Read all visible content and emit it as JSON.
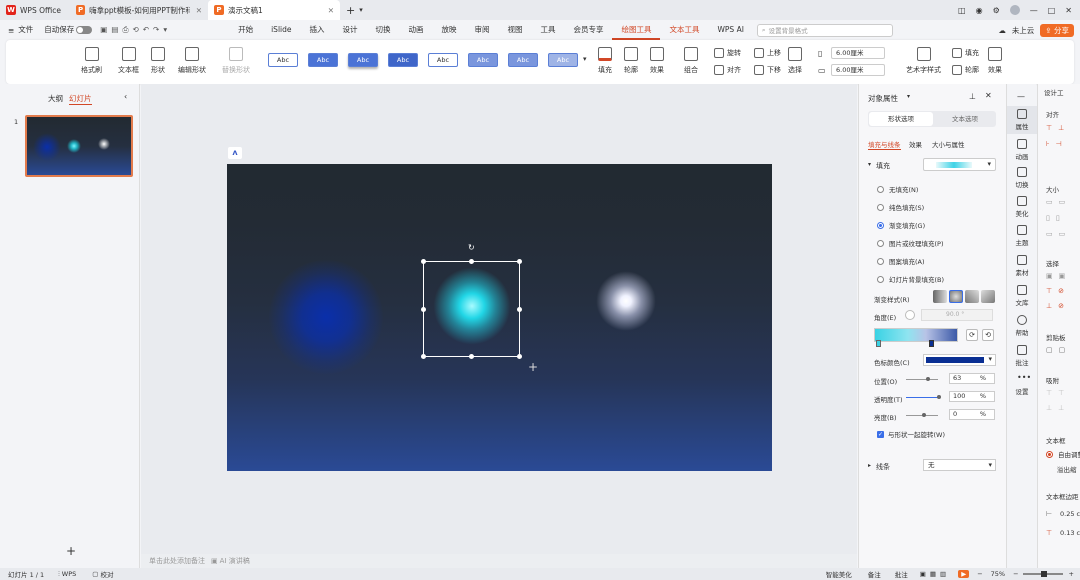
{
  "titlebar": {
    "tabs": [
      {
        "label": "WPS Office"
      },
      {
        "label": "嗨拿ppt模板-如何用PPT制作科技感..."
      },
      {
        "label": "演示文稿1"
      }
    ],
    "new_tab": "+"
  },
  "menubar": {
    "file": "文件",
    "autosave": "自动保存",
    "items": [
      "开始",
      "iSlide",
      "插入",
      "设计",
      "切换",
      "动画",
      "放映",
      "审阅",
      "视图",
      "工具",
      "会员专享",
      "绘图工具",
      "文本工具",
      "WPS AI"
    ],
    "search_placeholder": "设置背景格式",
    "cloud": "未上云",
    "share": "分享"
  },
  "ribbon": {
    "format_painter": "格式刷",
    "textbox": "文本框",
    "shape": "形状",
    "edit_shape": "编辑形状",
    "replace_shape": "替换形状",
    "style_label": "Abc",
    "fill": "填充",
    "outline": "轮廓",
    "effect": "效果",
    "group": "组合",
    "rotate": "旋转",
    "align": "对齐",
    "up": "上移",
    "down": "下移",
    "select": "选择",
    "height": "6.00厘米",
    "width": "6.00厘米",
    "art_text": "艺术字样式",
    "fill2": "填充",
    "outline2": "轮廓",
    "effect2": "效果"
  },
  "leftpanel": {
    "tab_outline": "大纲",
    "tab_slides": "幻灯片",
    "slide_number": "1",
    "add": "+"
  },
  "notes": {
    "placeholder": "单击此处添加备注",
    "ai": "AI 演讲稿"
  },
  "props": {
    "title": "对象属性",
    "tab_shape": "形状选项",
    "tab_text": "文本选项",
    "sub_fill": "填充与线条",
    "sub_effect": "效果",
    "sub_size": "大小与属性",
    "fill_section": "填充",
    "options": [
      "无填充(N)",
      "纯色填充(S)",
      "渐变填充(G)",
      "图片或纹理填充(P)",
      "图案填充(A)",
      "幻灯片背景填充(B)"
    ],
    "selected_option": 2,
    "gradient_style": "渐变样式(R)",
    "angle": "角度(E)",
    "angle_value": "90.0 °",
    "stop_color": "色标颜色(C)",
    "stop_color_value": "#0a2f93",
    "position": "位置(O)",
    "position_value": "63",
    "transparency": "透明度(T)",
    "transparency_value": "100",
    "brightness": "亮度(B)",
    "brightness_value": "0",
    "percent": "%",
    "rotate_with_shape": "与形状一起旋转(W)",
    "line_section": "线条",
    "line_value": "无"
  },
  "strip": [
    "属性",
    "动画",
    "切换",
    "美化",
    "主题",
    "素材",
    "文库",
    "帮助",
    "批注",
    "设置"
  ],
  "farright": {
    "title": "设计工",
    "align": "对齐",
    "size": "大小",
    "select": "选择",
    "clipboard": "剪贴板",
    "snap": "吸附",
    "textbox": "文本框",
    "auto_adjust": "自由调整",
    "overflow": "溢出缩",
    "textbox_margin": "文本框边距",
    "margin1": "0.25 c",
    "margin2": "0.13 c"
  },
  "statusbar": {
    "slide_info": "幻灯片 1 / 1",
    "wps": "WPS",
    "proof": "校对",
    "beautify": "智能美化",
    "notes": "备注",
    "comments": "批注",
    "zoom": "75%"
  },
  "colors": {
    "accent": "#d24726",
    "glow_left": "#0a2faa",
    "glow_mid": "#21d6e6",
    "glow_right": "#ffffff"
  }
}
